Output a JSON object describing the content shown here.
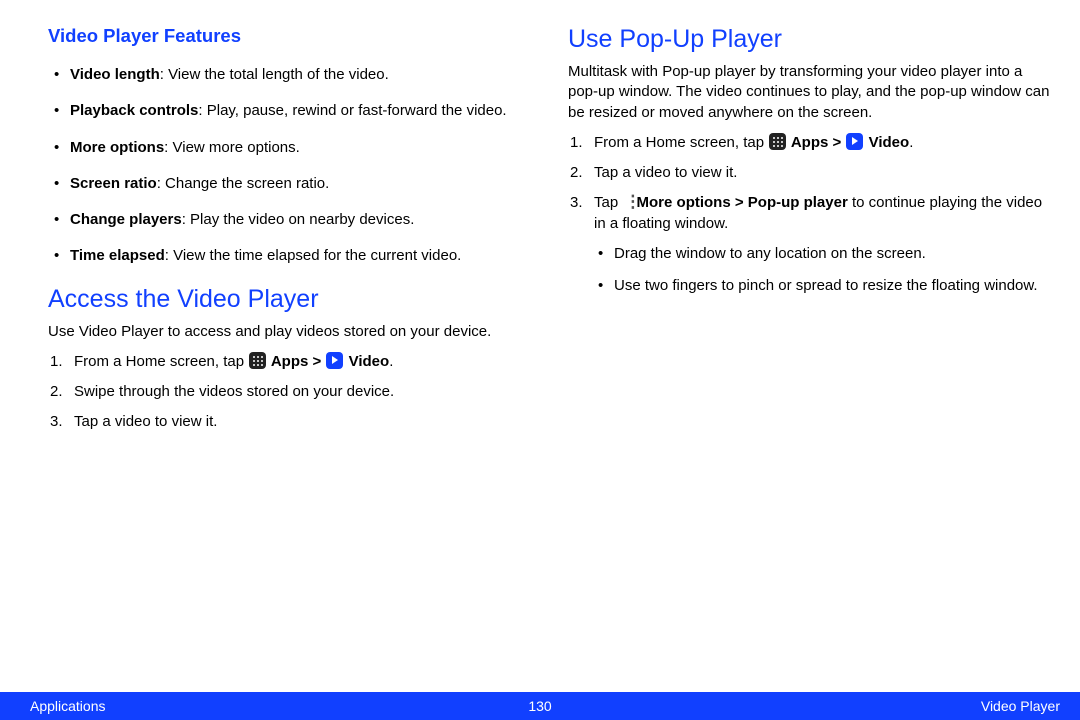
{
  "left": {
    "features_heading": "Video Player Features",
    "features": [
      {
        "term": "Video length",
        "desc": ": View the total length of the video."
      },
      {
        "term": "Playback controls",
        "desc": ": Play, pause, rewind or fast‑forward the video."
      },
      {
        "term": "More options",
        "desc": ": View more options."
      },
      {
        "term": "Screen ratio",
        "desc": ": Change the screen ratio."
      },
      {
        "term": "Change players",
        "desc": ": Play the video on nearby devices."
      },
      {
        "term": "Time elapsed",
        "desc": ": View the time elapsed for the current video."
      }
    ],
    "access_heading": "Access the Video Player",
    "access_intro": "Use Video Player to access and play videos stored on your device.",
    "step1_pre": "From a Home screen, tap ",
    "apps_label": " Apps > ",
    "video_label": " Video",
    "step1_post": ".",
    "step2": "Swipe through the videos stored on your device.",
    "step3": "Tap a video to view it."
  },
  "right": {
    "popup_heading": "Use Pop-Up Player",
    "popup_intro": "Multitask with Pop-up player by transforming your video player into a pop-up window. The video continues to play, and the pop-up window can be resized or moved anywhere on the screen.",
    "step1_pre": "From a Home screen, tap ",
    "apps_label": " Apps > ",
    "video_label": " Video",
    "step1_post": ".",
    "step2": "Tap a video to view it.",
    "step3_pre": "Tap ",
    "step3_bold": " More options > Pop-up player",
    "step3_post": " to continue playing the video in a floating window.",
    "sub1": "Drag the window to any location on the screen.",
    "sub2": "Use two fingers to pinch or spread to resize the floating window."
  },
  "footer": {
    "left": "Applications",
    "center": "130",
    "right": "Video Player"
  }
}
